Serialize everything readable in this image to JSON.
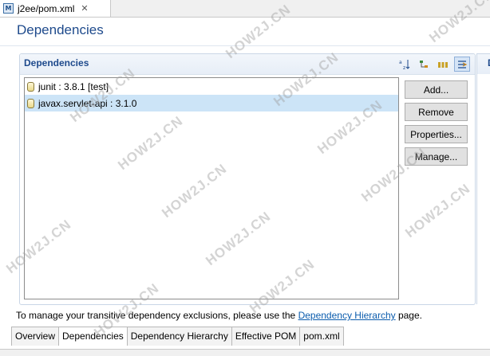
{
  "editor_tab": {
    "title": "j2ee/pom.xml",
    "icon": "maven-pom-icon"
  },
  "page_title": "Dependencies",
  "section": {
    "title": "Dependencies",
    "tools": [
      "sort-alpha-icon",
      "filter-icon",
      "collapse-icon",
      "toggle-icon"
    ]
  },
  "dependencies": [
    {
      "label": "junit : 3.8.1 [test]",
      "selected": false
    },
    {
      "label": "javax.servlet-api : 3.1.0",
      "selected": true
    }
  ],
  "buttons": {
    "add": "Add...",
    "remove": "Remove",
    "properties": "Properties...",
    "manage": "Manage..."
  },
  "right_panel_label": "D",
  "info": {
    "prefix": "To manage your transitive dependency exclusions, please use the ",
    "link": "Dependency Hierarchy",
    "suffix": " page."
  },
  "page_tabs": [
    {
      "label": "Overview",
      "active": false
    },
    {
      "label": "Dependencies",
      "active": true
    },
    {
      "label": "Dependency Hierarchy",
      "active": false
    },
    {
      "label": "Effective POM",
      "active": false
    },
    {
      "label": "pom.xml",
      "active": false
    }
  ],
  "watermark": "HOW2J.CN"
}
